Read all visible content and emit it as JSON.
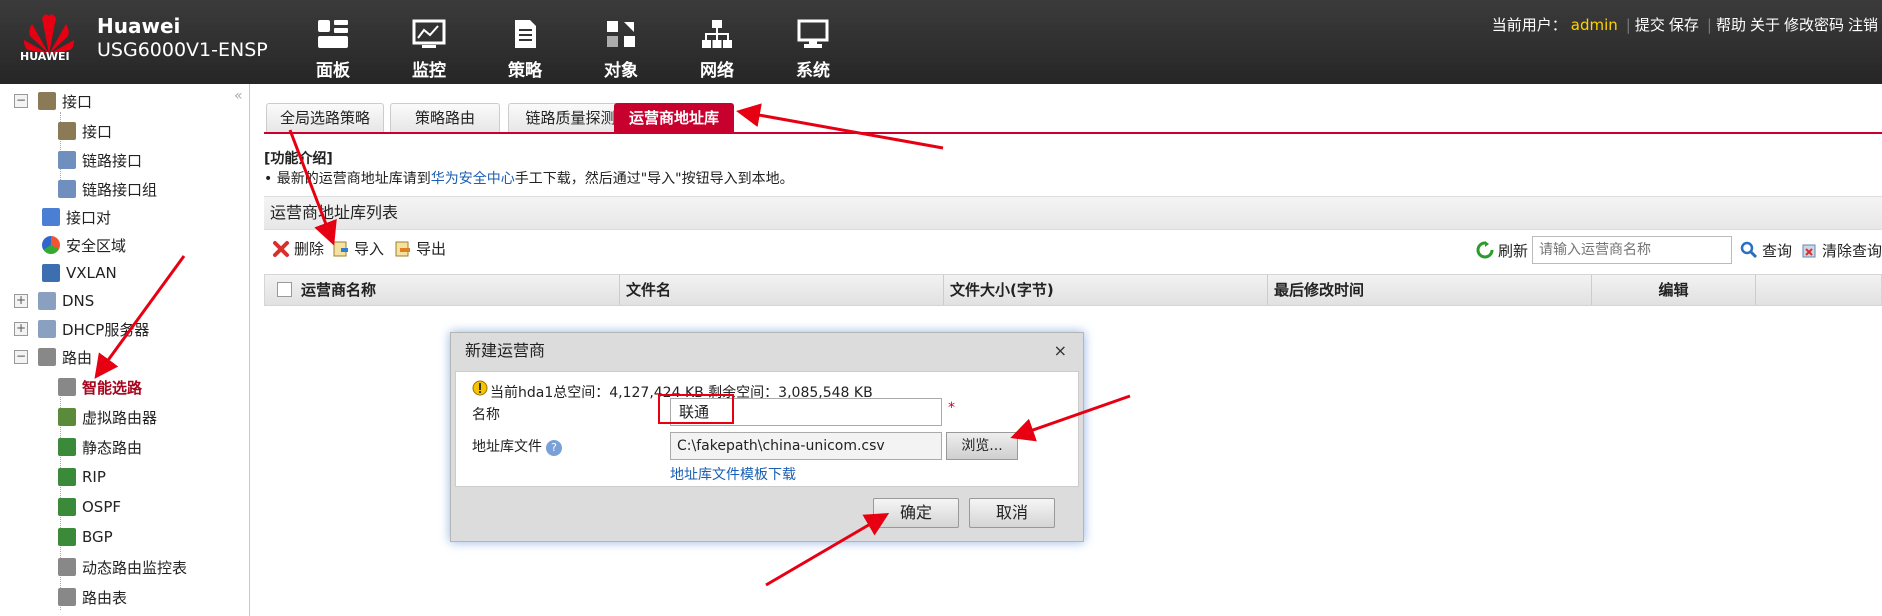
{
  "header": {
    "brand_name": "Huawei",
    "product": "USG6000V1-ENSP",
    "logo_text": "HUAWEI",
    "nav": [
      {
        "label": "面板",
        "icon": "dashboard-icon"
      },
      {
        "label": "监控",
        "icon": "monitor-icon"
      },
      {
        "label": "策略",
        "icon": "policy-icon"
      },
      {
        "label": "对象",
        "icon": "object-icon"
      },
      {
        "label": "网络",
        "icon": "network-icon"
      },
      {
        "label": "系统",
        "icon": "system-icon"
      }
    ],
    "current_user_label": "当前用户：",
    "current_user": "admin",
    "links": [
      "提交",
      "保存",
      "帮助",
      "关于",
      "修改密码",
      "注销"
    ]
  },
  "sidebar": {
    "items": [
      {
        "label": "接口",
        "toggle": "−"
      },
      {
        "label": "接口"
      },
      {
        "label": "链路接口"
      },
      {
        "label": "链路接口组"
      },
      {
        "label": "接口对"
      },
      {
        "label": "安全区域"
      },
      {
        "label": "VXLAN"
      },
      {
        "label": "DNS",
        "toggle": "+"
      },
      {
        "label": "DHCP服务器",
        "toggle": "+"
      },
      {
        "label": "路由",
        "toggle": "−"
      },
      {
        "label": "智能选路"
      },
      {
        "label": "虚拟路由器"
      },
      {
        "label": "静态路由"
      },
      {
        "label": "RIP"
      },
      {
        "label": "OSPF"
      },
      {
        "label": "BGP"
      },
      {
        "label": "动态路由监控表"
      },
      {
        "label": "路由表"
      }
    ],
    "collapse_glyph": "«"
  },
  "tabs": [
    "全局选路策略",
    "策略路由",
    "链路质量探测表",
    "运营商地址库"
  ],
  "intro": {
    "title": "[功能介绍]",
    "text_before": "最新的运营商地址库请到",
    "link": "华为安全中心",
    "text_after": "手工下载，然后通过\"导入\"按钮导入到本地。"
  },
  "panel": {
    "title": "运营商地址库列表",
    "delete": "删除",
    "import": "导入",
    "export": "导出",
    "refresh": "刷新",
    "search_placeholder": "请输入运营商名称",
    "query": "查询",
    "clear_query": "清除查询"
  },
  "table": {
    "columns": [
      "运营商名称",
      "文件名",
      "文件大小(字节)",
      "最后修改时间",
      "编辑"
    ]
  },
  "dialog": {
    "title": "新建运营商",
    "close": "×",
    "space_info": "当前hda1总空间：4,127,424 KB    剩余空间：3,085,548 KB",
    "name_label": "名称",
    "name_value": "联通",
    "required_mark": "*",
    "file_label": "地址库文件",
    "help_glyph": "?",
    "file_value": "C:\\fakepath\\china-unicom.csv",
    "browse": "浏览...",
    "template_link": "地址库文件模板下载",
    "ok": "确定",
    "cancel": "取消"
  },
  "colors": {
    "accent": "#c8002e",
    "annotation": "#e60012",
    "link": "#1a5fb4"
  }
}
